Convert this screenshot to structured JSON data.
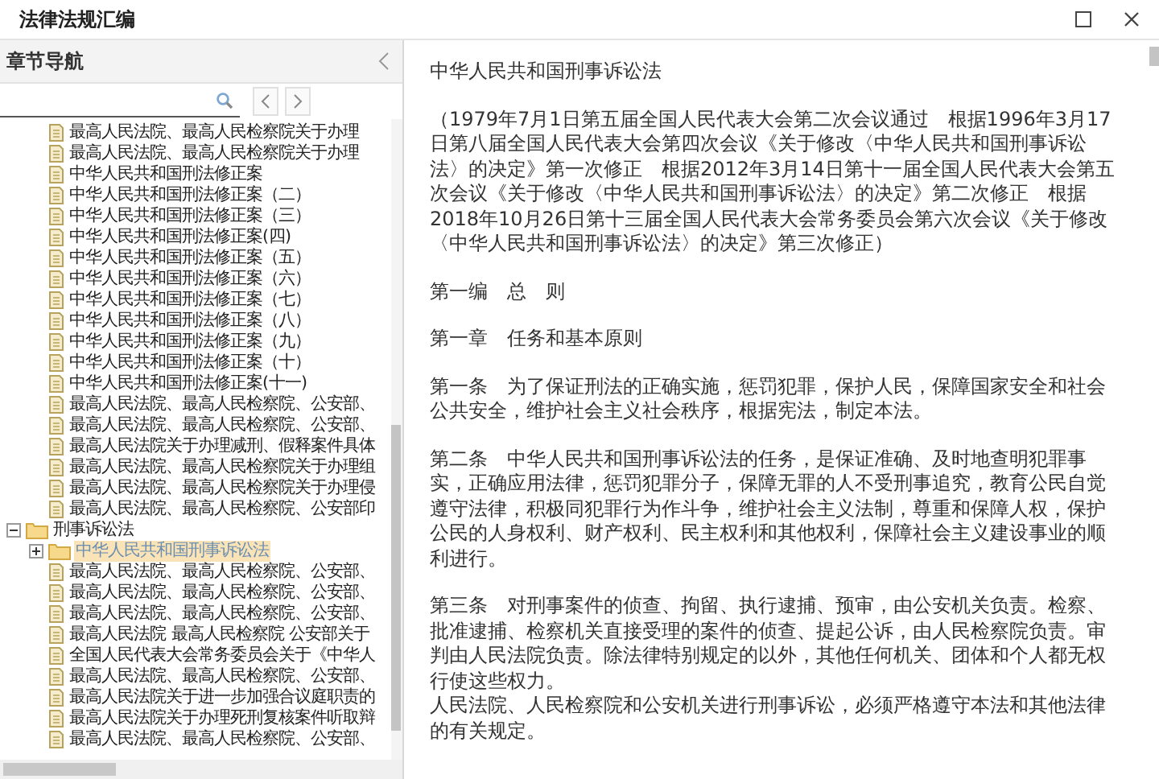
{
  "window": {
    "title": "法律法规汇编"
  },
  "sidebar": {
    "title": "章节导航",
    "tree": [
      {
        "kind": "file",
        "label": "最高人民法院、最高人民检察院关于办理",
        "selected": false
      },
      {
        "kind": "file",
        "label": "最高人民法院、最高人民检察院关于办理",
        "selected": false
      },
      {
        "kind": "file",
        "label": "中华人民共和国刑法修正案",
        "selected": false
      },
      {
        "kind": "file",
        "label": "中华人民共和国刑法修正案（二）",
        "selected": false
      },
      {
        "kind": "file",
        "label": "中华人民共和国刑法修正案（三）",
        "selected": false
      },
      {
        "kind": "file",
        "label": "中华人民共和国刑法修正案(四)",
        "selected": false
      },
      {
        "kind": "file",
        "label": "中华人民共和国刑法修正案（五）",
        "selected": false
      },
      {
        "kind": "file",
        "label": "中华人民共和国刑法修正案（六）",
        "selected": false
      },
      {
        "kind": "file",
        "label": "中华人民共和国刑法修正案（七）",
        "selected": false
      },
      {
        "kind": "file",
        "label": "中华人民共和国刑法修正案（八）",
        "selected": false
      },
      {
        "kind": "file",
        "label": "中华人民共和国刑法修正案（九）",
        "selected": false
      },
      {
        "kind": "file",
        "label": "中华人民共和国刑法修正案（十）",
        "selected": false
      },
      {
        "kind": "file",
        "label": "中华人民共和国刑法修正案(十一)",
        "selected": false
      },
      {
        "kind": "file",
        "label": "最高人民法院、最高人民检察院、公安部、",
        "selected": false
      },
      {
        "kind": "file",
        "label": "最高人民法院、最高人民检察院、公安部、",
        "selected": false
      },
      {
        "kind": "file",
        "label": "最高人民法院关于办理减刑、假释案件具体",
        "selected": false
      },
      {
        "kind": "file",
        "label": "最高人民法院、最高人民检察院关于办理组",
        "selected": false
      },
      {
        "kind": "file",
        "label": "最高人民法院、最高人民检察院关于办理侵",
        "selected": false
      },
      {
        "kind": "file",
        "label": "最高人民法院、最高人民检察院、公安部印",
        "selected": false
      },
      {
        "kind": "folder",
        "label": "刑事诉讼法",
        "selected": false,
        "expanded": true,
        "children": [
          {
            "kind": "folder",
            "label": "中华人民共和国刑事诉讼法",
            "selected": true,
            "expanded": false
          },
          {
            "kind": "file",
            "label": "最高人民法院、最高人民检察院、公安部、",
            "selected": false
          },
          {
            "kind": "file",
            "label": "最高人民法院、最高人民检察院、公安部、",
            "selected": false
          },
          {
            "kind": "file",
            "label": "最高人民法院、最高人民检察院、公安部、",
            "selected": false
          },
          {
            "kind": "file",
            "label": "最高人民法院 最高人民检察院 公安部关于",
            "selected": false
          },
          {
            "kind": "file",
            "label": "全国人民代表大会常务委员会关于《中华人",
            "selected": false
          },
          {
            "kind": "file",
            "label": "最高人民法院、最高人民检察院、公安部、",
            "selected": false
          },
          {
            "kind": "file",
            "label": "最高人民法院关于进一步加强合议庭职责的",
            "selected": false
          },
          {
            "kind": "file",
            "label": "最高人民法院关于办理死刑复核案件听取辩",
            "selected": false
          },
          {
            "kind": "file",
            "label": "最高人民法院、最高人民检察院、公安部、",
            "selected": false
          }
        ]
      }
    ]
  },
  "document": {
    "paragraphs": [
      {
        "text": "中华人民共和国刑事诉讼法"
      },
      {
        "text": "（1979年7月1日第五届全国人民代表大会第二次会议通过　根据1996年3月17日第八届全国人民代表大会第四次会议《关于修改〈中华人民共和国刑事诉讼法〉的决定》第一次修正　根据2012年3月14日第十一届全国人民代表大会第五次会议《关于修改〈中华人民共和国刑事诉讼法〉的决定》第二次修正　根据2018年10月26日第十三届全国人民代表大会常务委员会第六次会议《关于修改〈中华人民共和国刑事诉讼法〉的决定》第三次修正）"
      },
      {
        "text": "第一编　总　则"
      },
      {
        "text": "第一章　任务和基本原则"
      },
      {
        "text": "第一条　为了保证刑法的正确实施，惩罚犯罪，保护人民，保障国家安全和社会公共安全，维护社会主义社会秩序，根据宪法，制定本法。"
      },
      {
        "text": "第二条　中华人民共和国刑事诉讼法的任务，是保证准确、及时地查明犯罪事实，正确应用法律，惩罚犯罪分子，保障无罪的人不受刑事追究，教育公民自觉遵守法律，积极同犯罪行为作斗争，维护社会主义法制，尊重和保障人权，保护公民的人身权利、财产权利、民主权利和其他权利，保障社会主义建设事业的顺利进行。"
      },
      {
        "lines": [
          "第三条　对刑事案件的侦查、拘留、执行逮捕、预审，由公安机关负责。检察、批准逮捕、检察机关直接受理的案件的侦查、提起公诉，由人民检察院负责。审判由人民法院负责。除法律特别规定的以外，其他任何机关、团体和个人都无权行使这些权力。",
          "人民法院、人民检察院和公安机关进行刑事诉讼，必须严格遵守本法和其他法律的有关规定。"
        ]
      }
    ]
  }
}
